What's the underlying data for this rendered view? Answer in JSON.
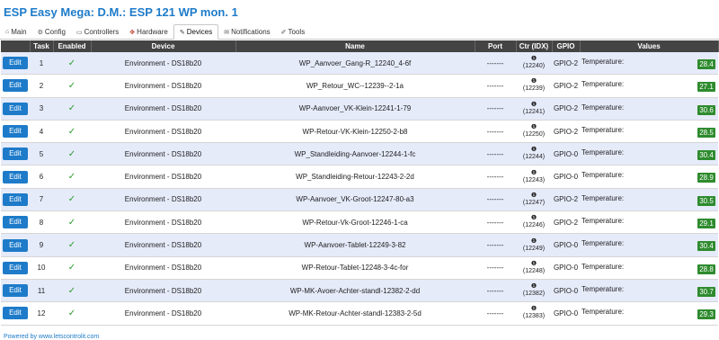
{
  "app": {
    "title": "ESP Easy Mega: D.M.: ESP 121 WP mon. 1"
  },
  "tabs": [
    {
      "label": "Main",
      "icon": "home-icon"
    },
    {
      "label": "Config",
      "icon": "gear-icon"
    },
    {
      "label": "Controllers",
      "icon": "chat-icon"
    },
    {
      "label": "Hardware",
      "icon": "pin-icon"
    },
    {
      "label": "Devices",
      "icon": "plug-icon",
      "active": true
    },
    {
      "label": "Notifications",
      "icon": "envelope-icon"
    },
    {
      "label": "Tools",
      "icon": "pencil-icon"
    }
  ],
  "table": {
    "headers": [
      "",
      "Task",
      "Enabled",
      "Device",
      "Name",
      "Port",
      "Ctr (IDX)",
      "GPIO",
      "Values"
    ],
    "edit_label": "Edit",
    "check_glyph": "✓",
    "ctr_glyph": "❶",
    "rows": [
      {
        "task": "1",
        "device": "Environment - DS18b20",
        "name": "WP_Aanvoer_Gang-R_12240_4-6f",
        "port": "-------",
        "idx": "(12240)",
        "gpio": "GPIO-2",
        "value_name": "Temperature:",
        "value": "28.4"
      },
      {
        "task": "2",
        "device": "Environment - DS18b20",
        "name": "WP_Retour_WC--12239--2-1a",
        "port": "-------",
        "idx": "(12239)",
        "gpio": "GPIO-2",
        "value_name": "Temperature:",
        "value": "27.1"
      },
      {
        "task": "3",
        "device": "Environment - DS18b20",
        "name": "WP-Aanvoer_VK-Klein-12241-1-79",
        "port": "-------",
        "idx": "(12241)",
        "gpio": "GPIO-2",
        "value_name": "Temperature:",
        "value": "30.6"
      },
      {
        "task": "4",
        "device": "Environment - DS18b20",
        "name": "WP-Retour-VK-Klein-12250-2-b8",
        "port": "-------",
        "idx": "(12250)",
        "gpio": "GPIO-2",
        "value_name": "Temperature:",
        "value": "28.5"
      },
      {
        "task": "5",
        "device": "Environment - DS18b20",
        "name": "WP_Standleiding-Aanvoer-12244-1-fc",
        "port": "-------",
        "idx": "(12244)",
        "gpio": "GPIO-0",
        "value_name": "Temperature:",
        "value": "30.4"
      },
      {
        "task": "6",
        "device": "Environment - DS18b20",
        "name": "WP_Standleiding-Retour-12243-2-2d",
        "port": "-------",
        "idx": "(12243)",
        "gpio": "GPIO-0",
        "value_name": "Temperature:",
        "value": "28.9"
      },
      {
        "task": "7",
        "device": "Environment - DS18b20",
        "name": "WP-Aanvoer_VK-Groot-12247-80-a3",
        "port": "-------",
        "idx": "(12247)",
        "gpio": "GPIO-2",
        "value_name": "Temperature:",
        "value": "30.5"
      },
      {
        "task": "8",
        "device": "Environment - DS18b20",
        "name": "WP-Retour-Vk-Groot-12246-1-ca",
        "port": "-------",
        "idx": "(12246)",
        "gpio": "GPIO-2",
        "value_name": "Temperature:",
        "value": "29.1"
      },
      {
        "task": "9",
        "device": "Environment - DS18b20",
        "name": "WP-Aanvoer-Tablet-12249-3-82",
        "port": "-------",
        "idx": "(12249)",
        "gpio": "GPIO-0",
        "value_name": "Temperature:",
        "value": "30.4"
      },
      {
        "task": "10",
        "device": "Environment - DS18b20",
        "name": "WP-Retour-Tablet-12248-3-4c-for",
        "port": "-------",
        "idx": "(12248)",
        "gpio": "GPIO-0",
        "value_name": "Temperature:",
        "value": "28.8"
      },
      {
        "task": "11",
        "device": "Environment - DS18b20",
        "name": "WP-MK-Avoer-Achter-standl-12382-2-dd",
        "port": "-------",
        "idx": "(12382)",
        "gpio": "GPIO-0",
        "value_name": "Temperature:",
        "value": "30.7"
      },
      {
        "task": "12",
        "device": "Environment - DS18b20",
        "name": "WP-MK-Retour-Achter-standl-12383-2-5d",
        "port": "-------",
        "idx": "(12383)",
        "gpio": "GPIO-0",
        "value_name": "Temperature:",
        "value": "29.3"
      }
    ]
  },
  "footer": {
    "text": "Powered by www.letscontrolit.com"
  },
  "colors": {
    "accent": "#1e7bc9",
    "header_bg": "#444444",
    "row_alt": "#e6ebfa",
    "value_badge": "#2e8b2e"
  }
}
